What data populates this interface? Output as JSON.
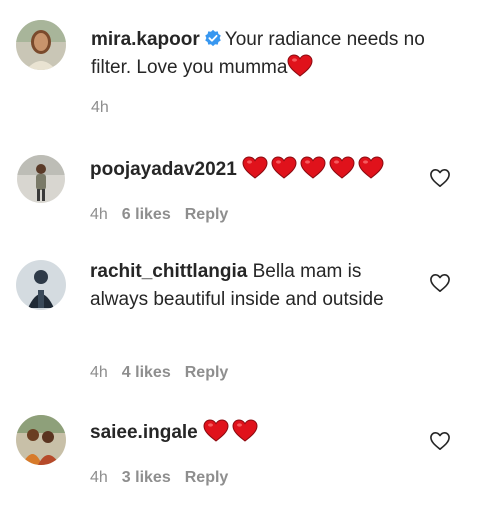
{
  "colors": {
    "text": "#262626",
    "meta": "#8e8e8e",
    "verified": "#3897f0",
    "heart": "#e0121b"
  },
  "comments": [
    {
      "username": "mira.kapoor",
      "verified": true,
      "text": "Your radiance needs no filter. Love you mumma",
      "emoji": [
        "red-heart"
      ],
      "time": "4h",
      "likes": "",
      "reply": ""
    },
    {
      "username": "poojayadav2021",
      "verified": false,
      "text": "",
      "emoji": [
        "red-heart",
        "red-heart",
        "red-heart",
        "red-heart",
        "red-heart"
      ],
      "time": "4h",
      "likes": "6 likes",
      "reply": "Reply"
    },
    {
      "username": "rachit_chittlangia",
      "verified": false,
      "text": "Bella mam is always beautiful inside and outside",
      "emoji": [],
      "time": "4h",
      "likes": "4 likes",
      "reply": "Reply"
    },
    {
      "username": "saiee.ingale",
      "verified": false,
      "text": "",
      "emoji": [
        "red-heart",
        "red-heart"
      ],
      "time": "4h",
      "likes": "3 likes",
      "reply": "Reply"
    }
  ]
}
